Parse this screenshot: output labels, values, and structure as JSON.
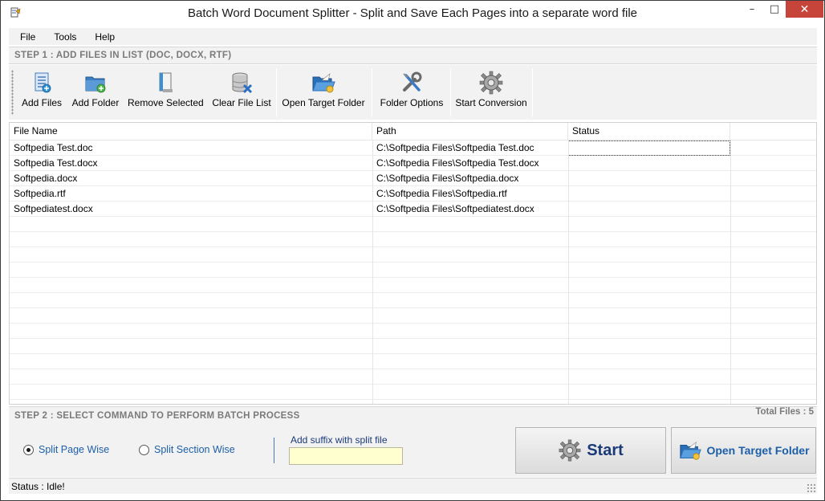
{
  "window": {
    "title": "Batch Word Document Splitter - Split and Save Each Pages into a separate word file",
    "minimize_glyph": "–",
    "maximize_glyph": "□",
    "close_glyph": "✕"
  },
  "menu": {
    "items": [
      {
        "label": "File"
      },
      {
        "label": "Tools"
      },
      {
        "label": "Help"
      }
    ]
  },
  "step1": {
    "label": "STEP 1 : ADD FILES IN LIST (DOC, DOCX, RTF)"
  },
  "toolbar": {
    "buttons": [
      {
        "label": "Add Files",
        "icon": "add-files-icon"
      },
      {
        "label": "Add Folder",
        "icon": "add-folder-icon"
      },
      {
        "label": "Remove Selected",
        "icon": "remove-selected-icon"
      },
      {
        "label": "Clear File List",
        "icon": "clear-list-icon"
      },
      {
        "label": "Open Target Folder",
        "icon": "open-folder-icon"
      },
      {
        "label": "Folder Options",
        "icon": "tools-icon"
      },
      {
        "label": "Start Conversion",
        "icon": "gear-icon"
      }
    ]
  },
  "file_list": {
    "columns": [
      "File Name",
      "Path",
      "Status"
    ],
    "rows": [
      {
        "name": "Softpedia Test.doc",
        "path": "C:\\Softpedia Files\\Softpedia Test.doc",
        "status": ""
      },
      {
        "name": "Softpedia Test.docx",
        "path": "C:\\Softpedia Files\\Softpedia Test.docx",
        "status": ""
      },
      {
        "name": "Softpedia.docx",
        "path": "C:\\Softpedia Files\\Softpedia.docx",
        "status": ""
      },
      {
        "name": "Softpedia.rtf",
        "path": "C:\\Softpedia Files\\Softpedia.rtf",
        "status": ""
      },
      {
        "name": "Softpediatest.docx",
        "path": "C:\\Softpedia Files\\Softpediatest.docx",
        "status": ""
      }
    ]
  },
  "step2": {
    "label": "STEP 2 : SELECT COMMAND TO PERFORM BATCH PROCESS",
    "total_files": "Total Files : 5"
  },
  "options": {
    "split_page_wise": {
      "label": "Split Page Wise",
      "checked": true
    },
    "split_section_wise": {
      "label": "Split Section Wise",
      "checked": false
    },
    "suffix_label": "Add suffix with split file",
    "suffix_value": ""
  },
  "actions": {
    "start_label": "Start",
    "open_target_label": "Open Target Folder"
  },
  "status": {
    "text": "Status  :  Idle!"
  },
  "colors": {
    "accent_blue": "#1c5fa8",
    "dark_blue": "#1a3a78",
    "close_red": "#c7443a",
    "suffix_field_bg": "#ffffcf",
    "panel_gray": "#f2f2f2"
  }
}
